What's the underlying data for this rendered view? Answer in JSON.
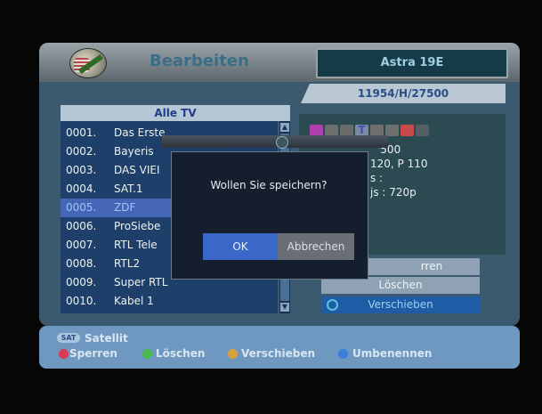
{
  "header": {
    "title": "Bearbeiten",
    "satellite": "Astra 19E"
  },
  "transponder": "11954/H/27500",
  "channel_list": {
    "title": "Alle TV",
    "rows": [
      {
        "num": "0001.",
        "name": "Das Erste"
      },
      {
        "num": "0002.",
        "name": "Bayeris"
      },
      {
        "num": "0003.",
        "name": "DAS VIEI"
      },
      {
        "num": "0004.",
        "name": "SAT.1"
      },
      {
        "num": "0005.",
        "name": "ZDF"
      },
      {
        "num": "0006.",
        "name": "ProSiebe"
      },
      {
        "num": "0007.",
        "name": "RTL Tele"
      },
      {
        "num": "0008.",
        "name": "RTL2"
      },
      {
        "num": "0009.",
        "name": "Super RTL"
      },
      {
        "num": "0010.",
        "name": "Kabel 1"
      }
    ],
    "selected_index": 4
  },
  "info": {
    "line1": "'500",
    "line2": "120, P 110",
    "line3": "s :",
    "line4": "js : 720p",
    "icons": [
      "tv-icon",
      "lock-icon",
      "text-T-icon",
      "scramble-icon",
      "flag-icon"
    ]
  },
  "options": {
    "sperren": "rren",
    "loeschen": "Löschen",
    "verschieben": "Verschieben"
  },
  "dialog": {
    "message": "Wollen Sie speichern?",
    "ok": "OK",
    "cancel": "Abbrechen"
  },
  "footer": {
    "sat_chip": "SAT",
    "sat_label": "Satellit",
    "keys": [
      {
        "color": "#d83a50",
        "label": "Sperren"
      },
      {
        "color": "#4db84d",
        "label": "Löschen"
      },
      {
        "color": "#d8a23a",
        "label": "Verschieben"
      },
      {
        "color": "#3d7ed8",
        "label": "Umbenennen"
      }
    ]
  }
}
